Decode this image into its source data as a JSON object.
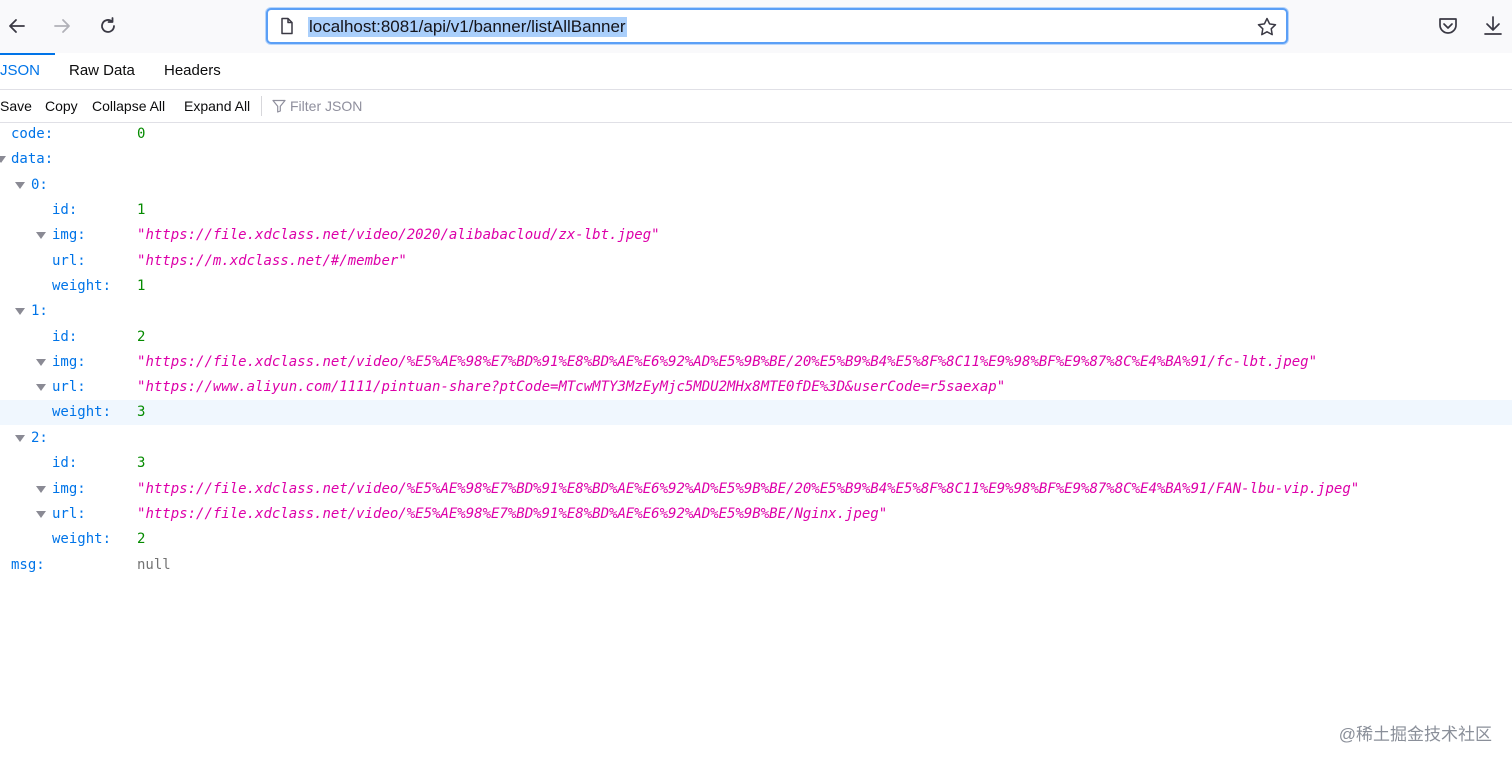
{
  "browser": {
    "url": "localhost:8081/api/v1/banner/listAllBanner"
  },
  "tabs": [
    {
      "label": "JSON",
      "active": true
    },
    {
      "label": "Raw Data",
      "active": false
    },
    {
      "label": "Headers",
      "active": false
    }
  ],
  "actions": {
    "save": "Save",
    "copy": "Copy",
    "collapse_all": "Collapse All",
    "expand_all": "Expand All",
    "filter_placeholder": "Filter JSON"
  },
  "json": {
    "code": {
      "key": "code:",
      "value": "0"
    },
    "data_key": "data:",
    "items": [
      {
        "key": "0:",
        "id": {
          "key": "id:",
          "value": "1"
        },
        "img": {
          "key": "img:",
          "value": "https://file.xdclass.net/video/2020/alibabacloud/zx-lbt.jpeg"
        },
        "url": {
          "key": "url:",
          "value": "https://m.xdclass.net/#/member"
        },
        "weight": {
          "key": "weight:",
          "value": "1"
        }
      },
      {
        "key": "1:",
        "id": {
          "key": "id:",
          "value": "2"
        },
        "img": {
          "key": "img:",
          "value": "https://file.xdclass.net/video/%E5%AE%98%E7%BD%91%E8%BD%AE%E6%92%AD%E5%9B%BE/20%E5%B9%B4%E5%8F%8C11%E9%98%BF%E9%87%8C%E4%BA%91/fc-lbt.jpeg"
        },
        "url": {
          "key": "url:",
          "value": "https://www.aliyun.com/1111/pintuan-share?ptCode=MTcwMTY3MzEyMjc5MDU2MHx8MTE0fDE%3D&userCode=r5saexap"
        },
        "weight": {
          "key": "weight:",
          "value": "3"
        }
      },
      {
        "key": "2:",
        "id": {
          "key": "id:",
          "value": "3"
        },
        "img": {
          "key": "img:",
          "value": "https://file.xdclass.net/video/%E5%AE%98%E7%BD%91%E8%BD%AE%E6%92%AD%E5%9B%BE/20%E5%B9%B4%E5%8F%8C11%E9%98%BF%E9%87%8C%E4%BA%91/FAN-lbu-vip.jpeg"
        },
        "url": {
          "key": "url:",
          "value": "https://file.xdclass.net/video/%E5%AE%98%E7%BD%91%E8%BD%AE%E6%92%AD%E5%9B%BE/Nginx.jpeg"
        },
        "weight": {
          "key": "weight:",
          "value": "2"
        }
      }
    ],
    "msg": {
      "key": "msg:",
      "value": "null"
    }
  },
  "watermark": "@稀土掘金技术社区"
}
